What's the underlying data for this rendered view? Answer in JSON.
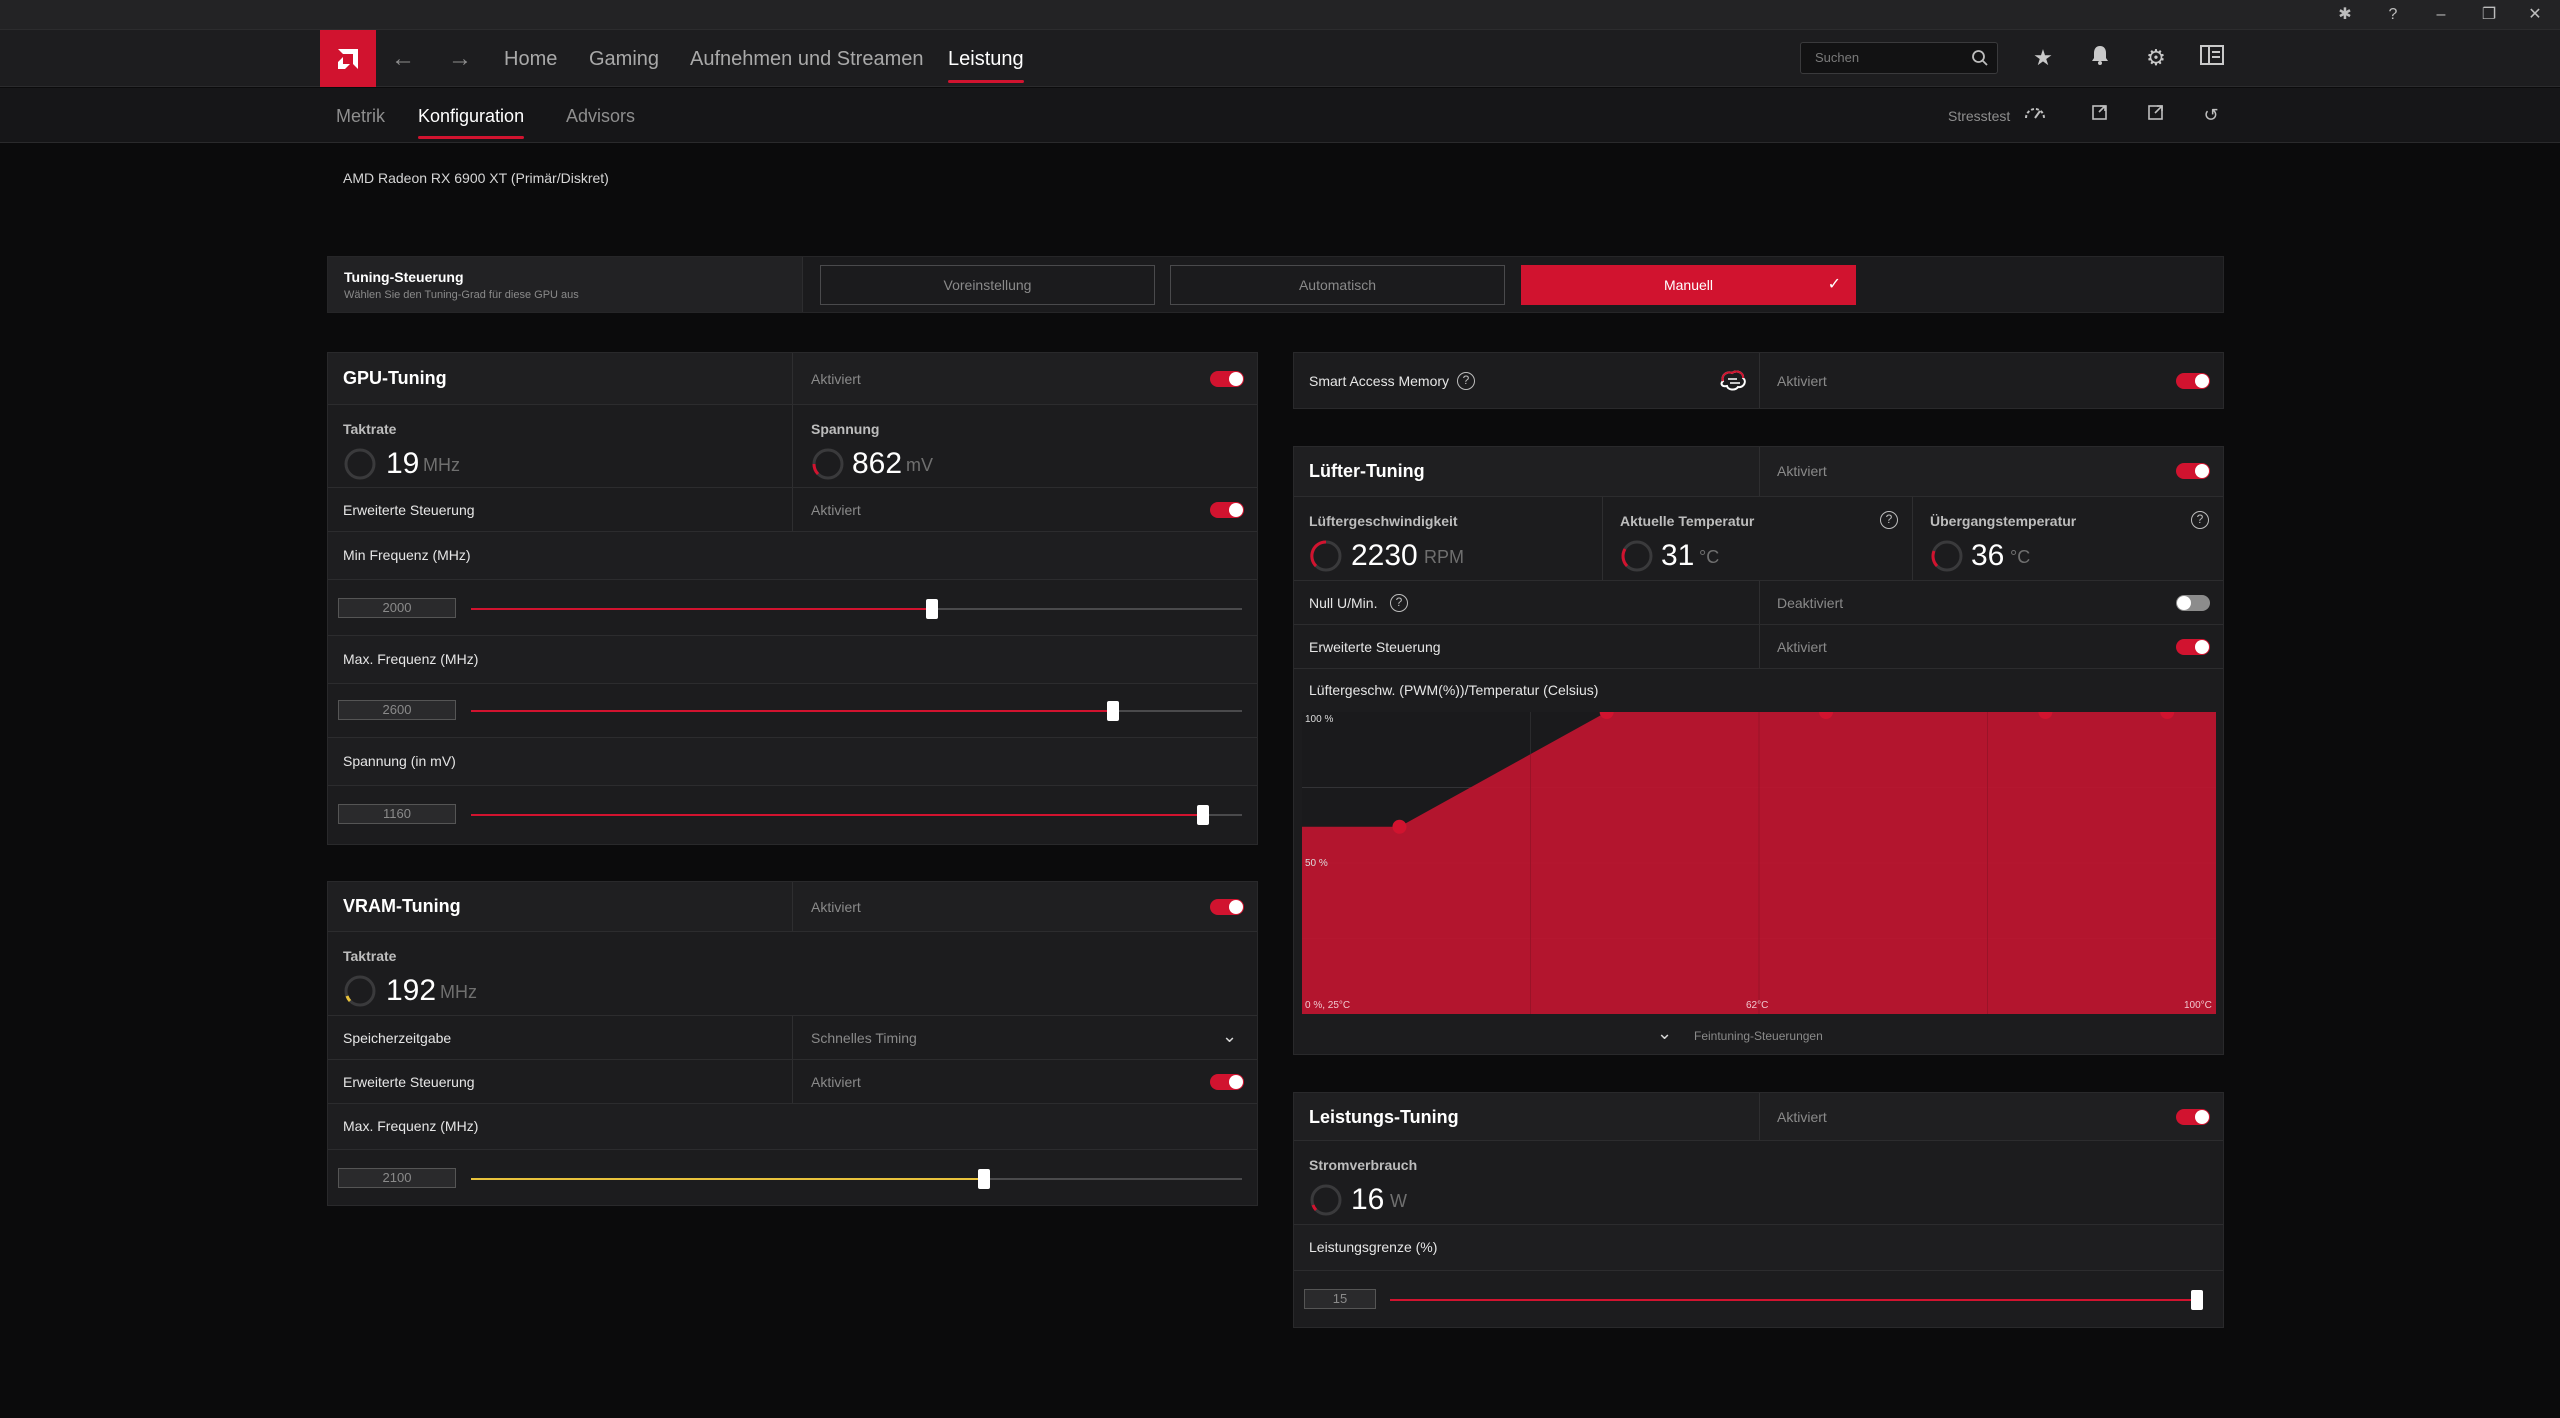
{
  "nav": {
    "items": [
      {
        "label": "Home",
        "active": false
      },
      {
        "label": "Gaming",
        "active": false
      },
      {
        "label": "Aufnehmen und Streamen",
        "active": false
      },
      {
        "label": "Leistung",
        "active": true
      }
    ],
    "search_placeholder": "Suchen"
  },
  "subnav": {
    "tabs": [
      {
        "label": "Metrik",
        "active": false
      },
      {
        "label": "Konfiguration",
        "active": true
      },
      {
        "label": "Advisors",
        "active": false
      }
    ],
    "stress_label": "Stresstest"
  },
  "gpu_name": "AMD Radeon RX 6900 XT (Primär/Diskret)",
  "tuning_control": {
    "title": "Tuning-Steuerung",
    "subtitle": "Wählen Sie den Tuning-Grad für diese GPU aus",
    "modes": [
      "Voreinstellung",
      "Automatisch",
      "Manuell"
    ],
    "selected": "Manuell"
  },
  "gpu_tuning": {
    "title": "GPU-Tuning",
    "status": "Aktiviert",
    "enabled": true,
    "clock": {
      "label": "Taktrate",
      "value": "19",
      "unit": "MHz"
    },
    "voltage": {
      "label": "Spannung",
      "value": "862",
      "unit": "mV"
    },
    "advanced": {
      "label": "Erweiterte Steuerung",
      "status": "Aktiviert",
      "enabled": true
    },
    "min_freq": {
      "label": "Min Frequenz (MHz)",
      "value": "2000",
      "fraction": 0.598
    },
    "max_freq": {
      "label": "Max. Frequenz (MHz)",
      "value": "2600",
      "fraction": 0.833
    },
    "voltage_mv": {
      "label": "Spannung (in mV)",
      "value": "1160",
      "fraction": 0.949
    }
  },
  "vram_tuning": {
    "title": "VRAM-Tuning",
    "status": "Aktiviert",
    "enabled": true,
    "clock": {
      "label": "Taktrate",
      "value": "192",
      "unit": "MHz"
    },
    "memory_timing": {
      "label": "Speicherzeitgabe",
      "value": "Schnelles Timing"
    },
    "advanced": {
      "label": "Erweiterte Steuerung",
      "status": "Aktiviert",
      "enabled": true
    },
    "max_freq": {
      "label": "Max. Frequenz (MHz)",
      "value": "2100",
      "fraction": 0.666
    }
  },
  "sam": {
    "label": "Smart Access Memory",
    "status": "Aktiviert",
    "enabled": true
  },
  "fan_tuning": {
    "title": "Lüfter-Tuning",
    "status": "Aktiviert",
    "enabled": true,
    "fan_speed": {
      "label": "Lüftergeschwindigkeit",
      "value": "2230",
      "unit": "RPM"
    },
    "current_temp": {
      "label": "Aktuelle Temperatur",
      "value": "31",
      "unit": "°C"
    },
    "junction_temp": {
      "label": "Übergangstemperatur",
      "value": "36",
      "unit": "°C"
    },
    "zero_rpm": {
      "label": "Null U/Min.",
      "status": "Deaktiviert",
      "enabled": false
    },
    "advanced": {
      "label": "Erweiterte Steuerung",
      "status": "Aktiviert",
      "enabled": true
    },
    "curve_title": "Lüftergeschw. (PWM(%))/Temperatur (Celsius)",
    "y_top_label": "100 %",
    "y_mid_label": "50 %",
    "x_start_label": "0 %, 25°C",
    "x_mid_label": "62°C",
    "x_end_label": "100°C",
    "fine_tuning": "Feintuning-Steuerungen"
  },
  "power_tuning": {
    "title": "Leistungs-Tuning",
    "status": "Aktiviert",
    "enabled": true,
    "power": {
      "label": "Stromverbrauch",
      "value": "16",
      "unit": "W"
    },
    "power_limit": {
      "label": "Leistungsgrenze (%)",
      "value": "15",
      "fraction": 0.996
    }
  },
  "colors": {
    "accent": "#d1132f",
    "vram_slider": "#e8c23c"
  },
  "chart_data": {
    "type": "area",
    "title": "Lüftergeschw. (PWM(%))/Temperatur (Celsius)",
    "x_min": 25,
    "x_max": 100,
    "ylim": [
      0,
      100
    ],
    "x": [
      25,
      33,
      50,
      68,
      86,
      96
    ],
    "values": [
      62,
      62,
      100,
      100,
      100,
      100
    ],
    "grid": true
  }
}
